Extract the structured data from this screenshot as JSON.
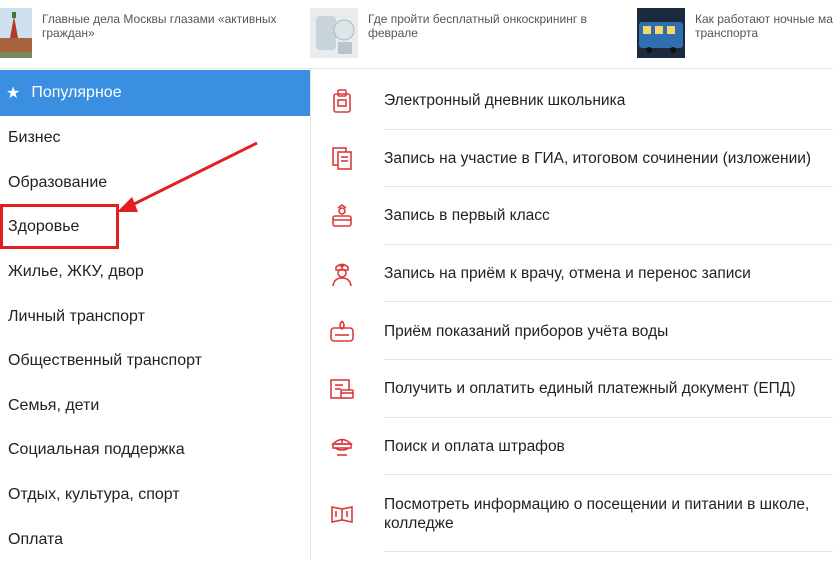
{
  "news": [
    {
      "title": "Главные дела Москвы глазами «активных граждан»",
      "thumb": "kremlin-thumbnail"
    },
    {
      "title": "Где пройти бесплатный онкоскрининг в феврале",
      "thumb": "medical-equipment-thumbnail"
    },
    {
      "title": "Как работают ночные ма транспорта",
      "thumb": "night-bus-thumbnail"
    }
  ],
  "sidebar": {
    "active": {
      "label": "Популярное",
      "icon": "star-icon"
    },
    "items": [
      {
        "label": "Бизнес"
      },
      {
        "label": "Образование"
      },
      {
        "label": "Здоровье"
      },
      {
        "label": "Жилье, ЖКУ, двор"
      },
      {
        "label": "Личный транспорт"
      },
      {
        "label": "Общественный транспорт"
      },
      {
        "label": "Семья, дети"
      },
      {
        "label": "Социальная поддержка"
      },
      {
        "label": "Отдых, культура, спорт"
      },
      {
        "label": "Оплата"
      }
    ]
  },
  "services": [
    {
      "label": "Электронный дневник школьника",
      "icon": "school-diary-icon"
    },
    {
      "label": "Запись на участие в ГИА, итоговом сочинении (изложении)",
      "icon": "exam-document-icon"
    },
    {
      "label": "Запись в первый класс",
      "icon": "first-class-icon"
    },
    {
      "label": "Запись на приём к врачу, отмена и перенос записи",
      "icon": "doctor-icon"
    },
    {
      "label": "Приём показаний приборов учёта воды",
      "icon": "water-meter-icon"
    },
    {
      "label": "Получить и оплатить единый платежный документ (ЕПД)",
      "icon": "payment-document-icon"
    },
    {
      "label": "Поиск и оплата штрафов",
      "icon": "police-cap-icon"
    },
    {
      "label": "Посмотреть информацию о посещении и питании в школе, колледже",
      "icon": "school-meals-icon"
    }
  ],
  "colors": {
    "accent": "#3b8fe0",
    "annotation": "#e02020",
    "icon": "#d93b3b"
  }
}
